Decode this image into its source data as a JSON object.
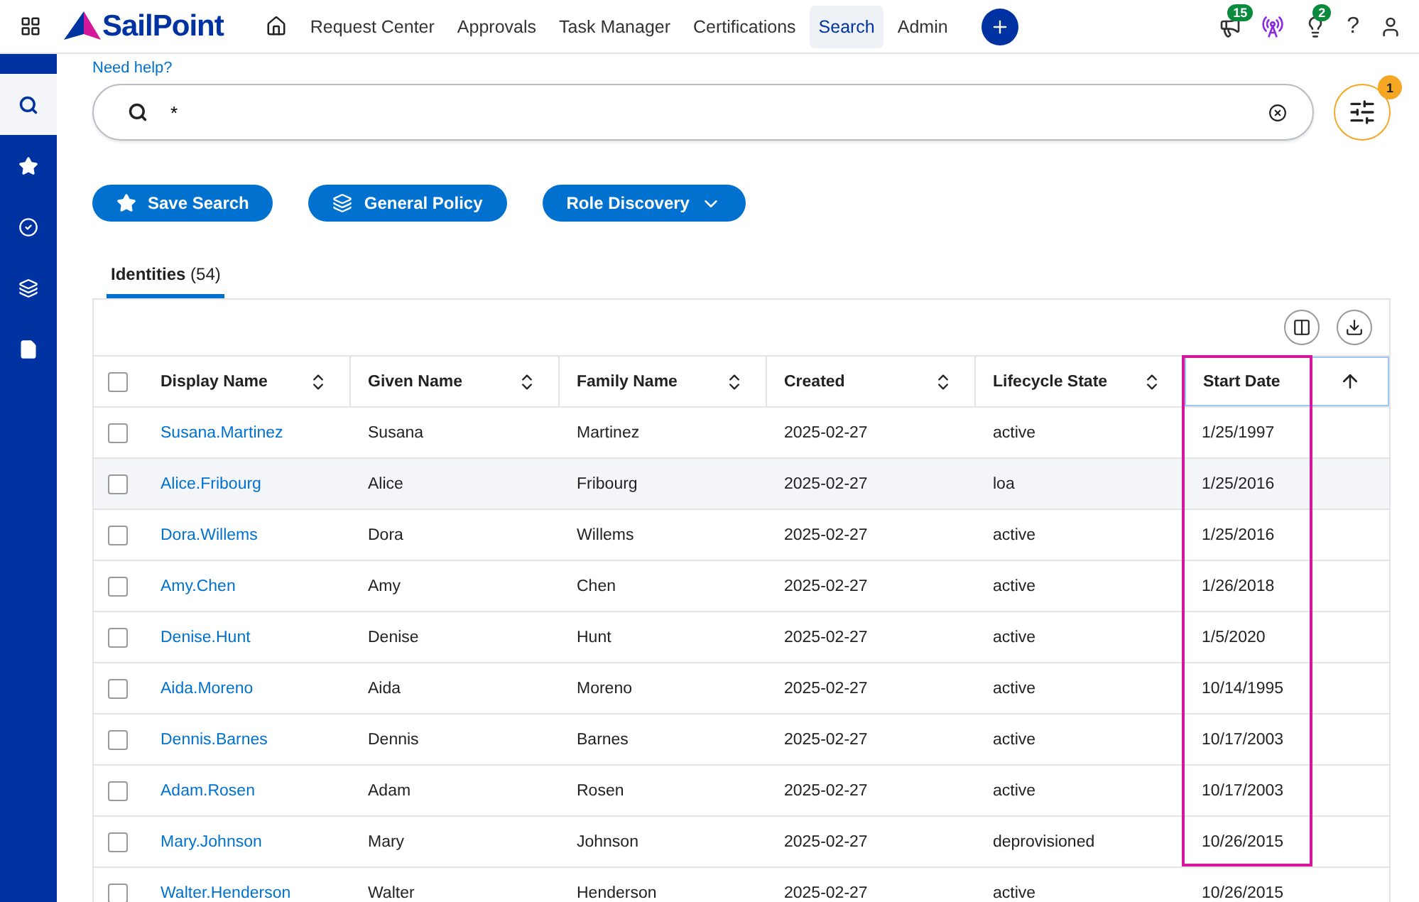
{
  "app": {
    "logo": "SailPoint"
  },
  "nav": [
    {
      "label": "Request Center",
      "selected": false
    },
    {
      "label": "Approvals",
      "selected": false
    },
    {
      "label": "Task Manager",
      "selected": false
    },
    {
      "label": "Certifications",
      "selected": false
    },
    {
      "label": "Search",
      "selected": true
    },
    {
      "label": "Admin",
      "selected": false
    }
  ],
  "header_icons": [
    {
      "kind": "megaphone",
      "badge": "15"
    },
    {
      "kind": "tower"
    },
    {
      "kind": "bulb",
      "badge": "2"
    },
    {
      "kind": "help",
      "label": "?"
    },
    {
      "kind": "user"
    }
  ],
  "sidebar": [
    {
      "kind": "search",
      "selected": true
    },
    {
      "kind": "star",
      "selected": false
    },
    {
      "kind": "check",
      "selected": false
    },
    {
      "kind": "layers",
      "selected": false
    },
    {
      "kind": "file",
      "selected": false
    }
  ],
  "help_link": "Need help?",
  "search": {
    "value": "*"
  },
  "filter_badge": "1",
  "actions": [
    {
      "kind": "star",
      "label": "Save Search"
    },
    {
      "kind": "layers",
      "label": "General Policy"
    },
    {
      "kind": "dropdown",
      "label": "Role Discovery"
    }
  ],
  "tabs": [
    {
      "label": "Identities",
      "count": "(54)",
      "selected": true
    }
  ],
  "table": {
    "header_checked": false,
    "columns": [
      {
        "label": "Display Name",
        "sorted": false,
        "highlighted": false
      },
      {
        "label": "Given Name",
        "sorted": false,
        "highlighted": false
      },
      {
        "label": "Family Name",
        "sorted": false,
        "highlighted": false
      },
      {
        "label": "Created",
        "sorted": false,
        "highlighted": false
      },
      {
        "label": "Lifecycle State",
        "sorted": false,
        "highlighted": false
      },
      {
        "label": "Start Date",
        "sorted": true,
        "highlighted": true
      }
    ],
    "rows": [
      {
        "checked": false,
        "hovered": false,
        "cells": [
          "Susana.Martinez",
          "Susana",
          "Martinez",
          "2025-02-27",
          "active",
          "1/25/1997"
        ]
      },
      {
        "checked": false,
        "hovered": true,
        "cells": [
          "Alice.Fribourg",
          "Alice",
          "Fribourg",
          "2025-02-27",
          "loa",
          "1/25/2016"
        ]
      },
      {
        "checked": false,
        "hovered": false,
        "cells": [
          "Dora.Willems",
          "Dora",
          "Willems",
          "2025-02-27",
          "active",
          "1/25/2016"
        ]
      },
      {
        "checked": false,
        "hovered": false,
        "cells": [
          "Amy.Chen",
          "Amy",
          "Chen",
          "2025-02-27",
          "active",
          "1/26/2018"
        ]
      },
      {
        "checked": false,
        "hovered": false,
        "cells": [
          "Denise.Hunt",
          "Denise",
          "Hunt",
          "2025-02-27",
          "active",
          "1/5/2020"
        ]
      },
      {
        "checked": false,
        "hovered": false,
        "cells": [
          "Aida.Moreno",
          "Aida",
          "Moreno",
          "2025-02-27",
          "active",
          "10/14/1995"
        ]
      },
      {
        "checked": false,
        "hovered": false,
        "cells": [
          "Dennis.Barnes",
          "Dennis",
          "Barnes",
          "2025-02-27",
          "active",
          "10/17/2003"
        ]
      },
      {
        "checked": false,
        "hovered": false,
        "cells": [
          "Adam.Rosen",
          "Adam",
          "Rosen",
          "2025-02-27",
          "active",
          "10/17/2003"
        ]
      },
      {
        "checked": false,
        "hovered": false,
        "cells": [
          "Mary.Johnson",
          "Mary",
          "Johnson",
          "2025-02-27",
          "deprovisioned",
          "10/26/2015"
        ]
      },
      {
        "checked": false,
        "hovered": false,
        "cells": [
          "Walter.Henderson",
          "Walter",
          "Henderson",
          "2025-02-27",
          "active",
          "10/26/2015"
        ]
      }
    ]
  }
}
